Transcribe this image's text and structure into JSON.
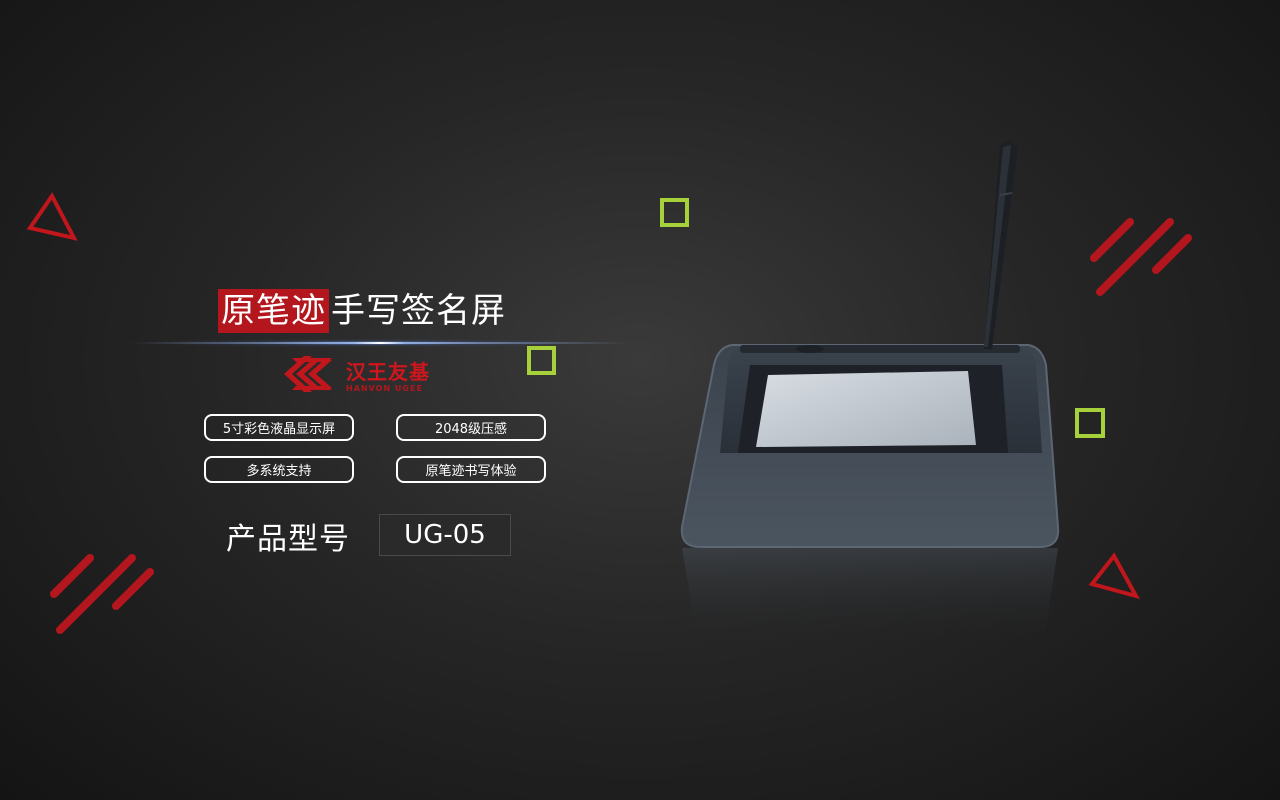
{
  "title": {
    "highlight": "原笔迹",
    "rest": "手写签名屏"
  },
  "brand": {
    "name_cn": "汉王友基",
    "name_en": "HANVON UGEE"
  },
  "features": [
    {
      "label": "5寸彩色液晶显示屏"
    },
    {
      "label": "2048级压感"
    },
    {
      "label": "多系统支持"
    },
    {
      "label": "原笔迹书写体验"
    }
  ],
  "model": {
    "label": "产品型号",
    "value": "UG-05"
  },
  "colors": {
    "accent_red": "#b3161c",
    "accent_green": "#a6d13a",
    "background": "#222222"
  },
  "decorations": [
    "triangle-outline-red",
    "slash-lines-red",
    "square-outline-green"
  ],
  "product_image": "signature-pad-with-stylus"
}
